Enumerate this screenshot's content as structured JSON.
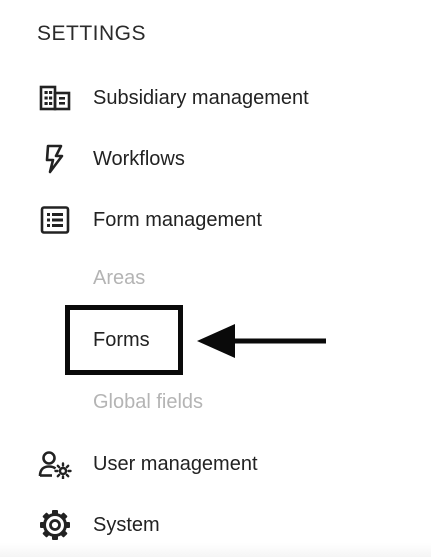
{
  "settings": {
    "title": "SETTINGS",
    "items": [
      {
        "label": "Subsidiary management",
        "icon": "building-icon"
      },
      {
        "label": "Workflows",
        "icon": "lightning-icon"
      },
      {
        "label": "Form management",
        "icon": "list-icon"
      },
      {
        "label": "User management",
        "icon": "user-gear-icon"
      },
      {
        "label": "System",
        "icon": "gear-icon"
      }
    ],
    "form_management_subitems": [
      {
        "label": "Areas",
        "active": false
      },
      {
        "label": "Forms",
        "active": true
      },
      {
        "label": "Global fields",
        "active": false
      }
    ]
  },
  "colors": {
    "text": "#222222",
    "muted": "#b4b4b4",
    "annotation": "#0a0a0a"
  }
}
